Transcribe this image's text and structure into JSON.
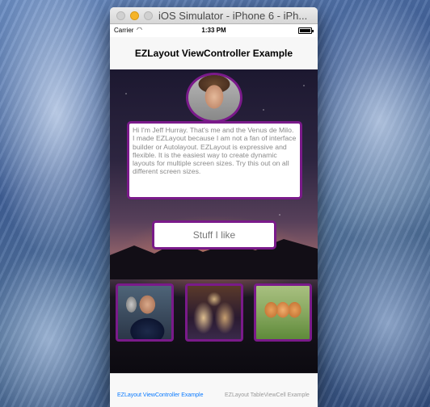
{
  "window": {
    "title": "iOS Simulator - iPhone 6 - iPh..."
  },
  "status_bar": {
    "carrier": "Carrier",
    "wifi_icon": "wifi-icon",
    "time": "1:33 PM",
    "battery_icon": "battery-icon"
  },
  "nav": {
    "title": "EZLayout ViewController Example"
  },
  "profile": {
    "bio": "Hi I'm Jeff Hurray. That's me and the Venus de Milo. I made EZLayout because I am not a fan of interface builder or Autolayout. EZLayout is expressive and flexible. It is the easiest way to create dynamic layouts for multiple screen sizes. Try this out on all different screen sizes.",
    "button_label": "Stuff I like"
  },
  "tabs": [
    {
      "label": "EZLayout ViewController Example",
      "active": true
    },
    {
      "label": "EZLayout TableViewCell Example",
      "active": false
    }
  ],
  "colors": {
    "accent_border": "#7a1a8a",
    "tab_active": "#0a7aff"
  }
}
